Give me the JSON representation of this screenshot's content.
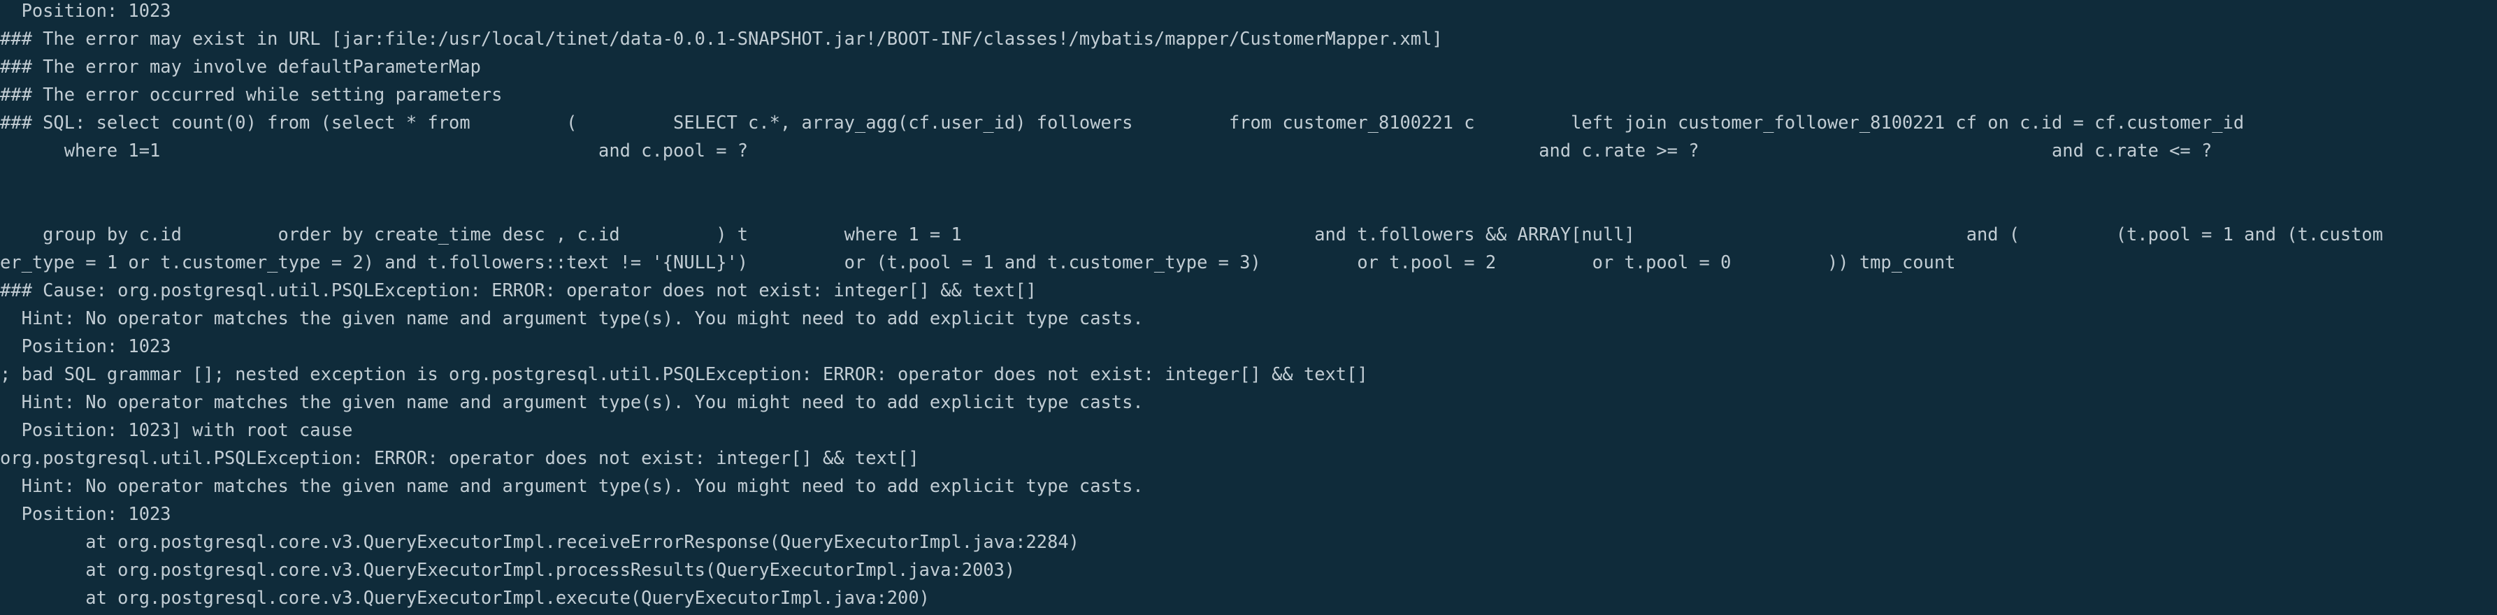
{
  "terminal": {
    "background": "#0f2b3a",
    "foreground": "#c2cdd4",
    "lines": [
      "  Position: 1023",
      "### The error may exist in URL [jar:file:/usr/local/tinet/data-0.0.1-SNAPSHOT.jar!/BOOT-INF/classes!/mybatis/mapper/CustomerMapper.xml]",
      "### The error may involve defaultParameterMap",
      "### The error occurred while setting parameters",
      "### SQL: select count(0) from (select * from         (         SELECT c.*, array_agg(cf.user_id) followers         from customer_8100221 c         left join customer_follower_8100221 cf on c.id = cf.customer_id",
      "      where 1=1                                         and c.pool = ?                                                                          and c.rate >= ?                                 and c.rate <= ?",
      "",
      "",
      "    group by c.id         order by create_time desc , c.id         ) t         where 1 = 1                                 and t.followers && ARRAY[null]                               and (         (t.pool = 1 and (t.custom",
      "er_type = 1 or t.customer_type = 2) and t.followers::text != '{NULL}')         or (t.pool = 1 and t.customer_type = 3)         or t.pool = 2         or t.pool = 0         )) tmp_count",
      "### Cause: org.postgresql.util.PSQLException: ERROR: operator does not exist: integer[] && text[]",
      "  Hint: No operator matches the given name and argument type(s). You might need to add explicit type casts.",
      "  Position: 1023",
      "; bad SQL grammar []; nested exception is org.postgresql.util.PSQLException: ERROR: operator does not exist: integer[] && text[]",
      "  Hint: No operator matches the given name and argument type(s). You might need to add explicit type casts.",
      "  Position: 1023] with root cause",
      "org.postgresql.util.PSQLException: ERROR: operator does not exist: integer[] && text[]",
      "  Hint: No operator matches the given name and argument type(s). You might need to add explicit type casts.",
      "  Position: 1023",
      "        at org.postgresql.core.v3.QueryExecutorImpl.receiveErrorResponse(QueryExecutorImpl.java:2284)",
      "        at org.postgresql.core.v3.QueryExecutorImpl.processResults(QueryExecutorImpl.java:2003)",
      "        at org.postgresql.core.v3.QueryExecutorImpl.execute(QueryExecutorImpl.java:200)"
    ]
  }
}
